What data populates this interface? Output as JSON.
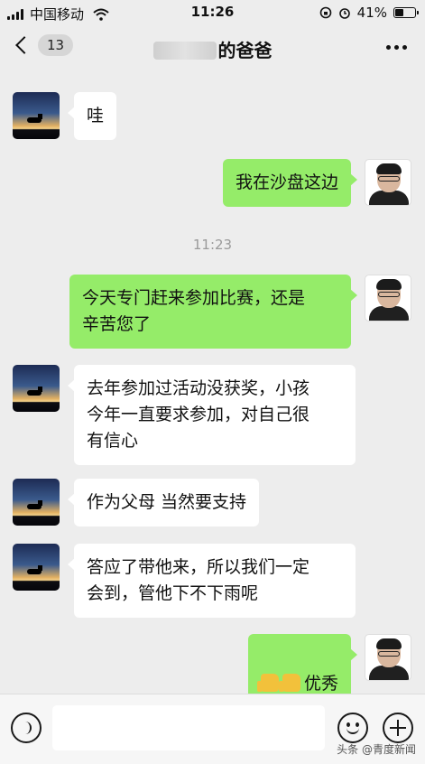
{
  "status_bar": {
    "carrier": "中国移动",
    "time": "11:26",
    "battery": "41%",
    "battery_level": 0.41
  },
  "nav": {
    "unread_count": "13",
    "title": "的爸爸"
  },
  "messages": [
    {
      "side": "in",
      "text": "哇"
    },
    {
      "side": "out",
      "text": "我在沙盘这边"
    },
    {
      "side": "out",
      "text": "今天专门赶来参加比赛，还是\n辛苦您了"
    },
    {
      "side": "in",
      "text": "去年参加过活动没获奖，小孩\n今年一直要求参加，对自己很\n有信心"
    },
    {
      "side": "in",
      "text": "作为父母 当然要支持"
    },
    {
      "side": "in",
      "text": "答应了带他来，所以我们一定\n会到，管他下不下雨呢"
    },
    {
      "side": "out",
      "text": "优秀"
    }
  ],
  "timestamp": "11:23",
  "watermark": "头条 @青度新闻"
}
